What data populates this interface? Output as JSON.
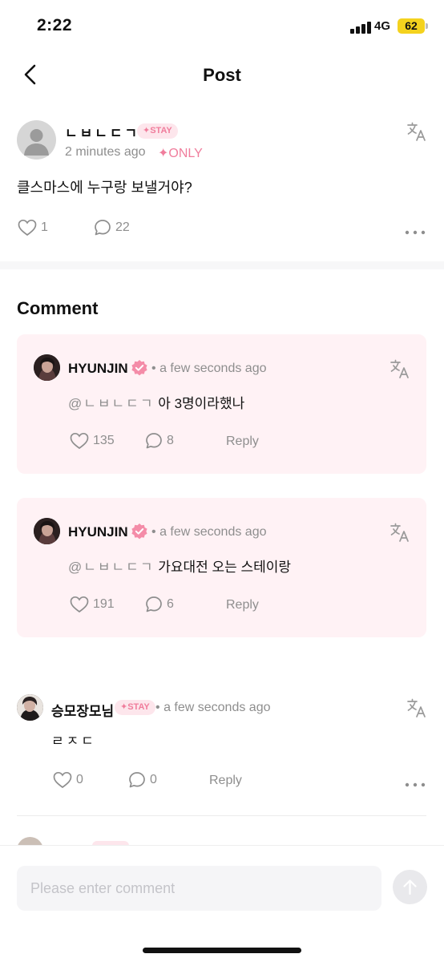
{
  "status_bar": {
    "time": "2:22",
    "network": "4G",
    "battery": "62"
  },
  "nav": {
    "title": "Post"
  },
  "post": {
    "author": "ㄴㅂㄴㄷㄱ",
    "badge": "✦STAY",
    "time": "2 minutes ago",
    "visibility": "✦ONLY",
    "text": "클스마스에 누구랑 보낼거야?",
    "likes": "1",
    "comments": "22"
  },
  "comments_section": {
    "title": "Comment"
  },
  "comments": [
    {
      "name": "HYUNJIN",
      "separator": "•",
      "time": "a few seconds ago",
      "mention": "@ㄴㅂㄴㄷㄱ",
      "text": "아 3명이라했나",
      "likes": "135",
      "replies": "8",
      "reply_label": "Reply"
    },
    {
      "name": "HYUNJIN",
      "separator": "•",
      "time": "a few seconds ago",
      "mention": "@ㄴㅂㄴㄷㄱ",
      "text": "가요대전 오는 스테이랑",
      "likes": "191",
      "replies": "6",
      "reply_label": "Reply"
    },
    {
      "name": "승모장모님",
      "badge": "✦STAY",
      "separator": "•",
      "time": "a few seconds ago",
      "text": "ㄹㅈㄷ",
      "likes": "0",
      "replies": "0",
      "reply_label": "Reply"
    }
  ],
  "composer": {
    "placeholder": "Please enter comment"
  },
  "colors": {
    "accent_pink": "#f07d9c",
    "card_bg": "#fff2f5",
    "badge_bg": "#fde6ec",
    "muted": "#8e8e8e"
  },
  "icons": [
    "back-arrow-icon",
    "translate-icon",
    "heart-icon",
    "comment-bubble-icon",
    "more-dots-icon",
    "verified-badge-icon",
    "send-arrow-icon"
  ]
}
